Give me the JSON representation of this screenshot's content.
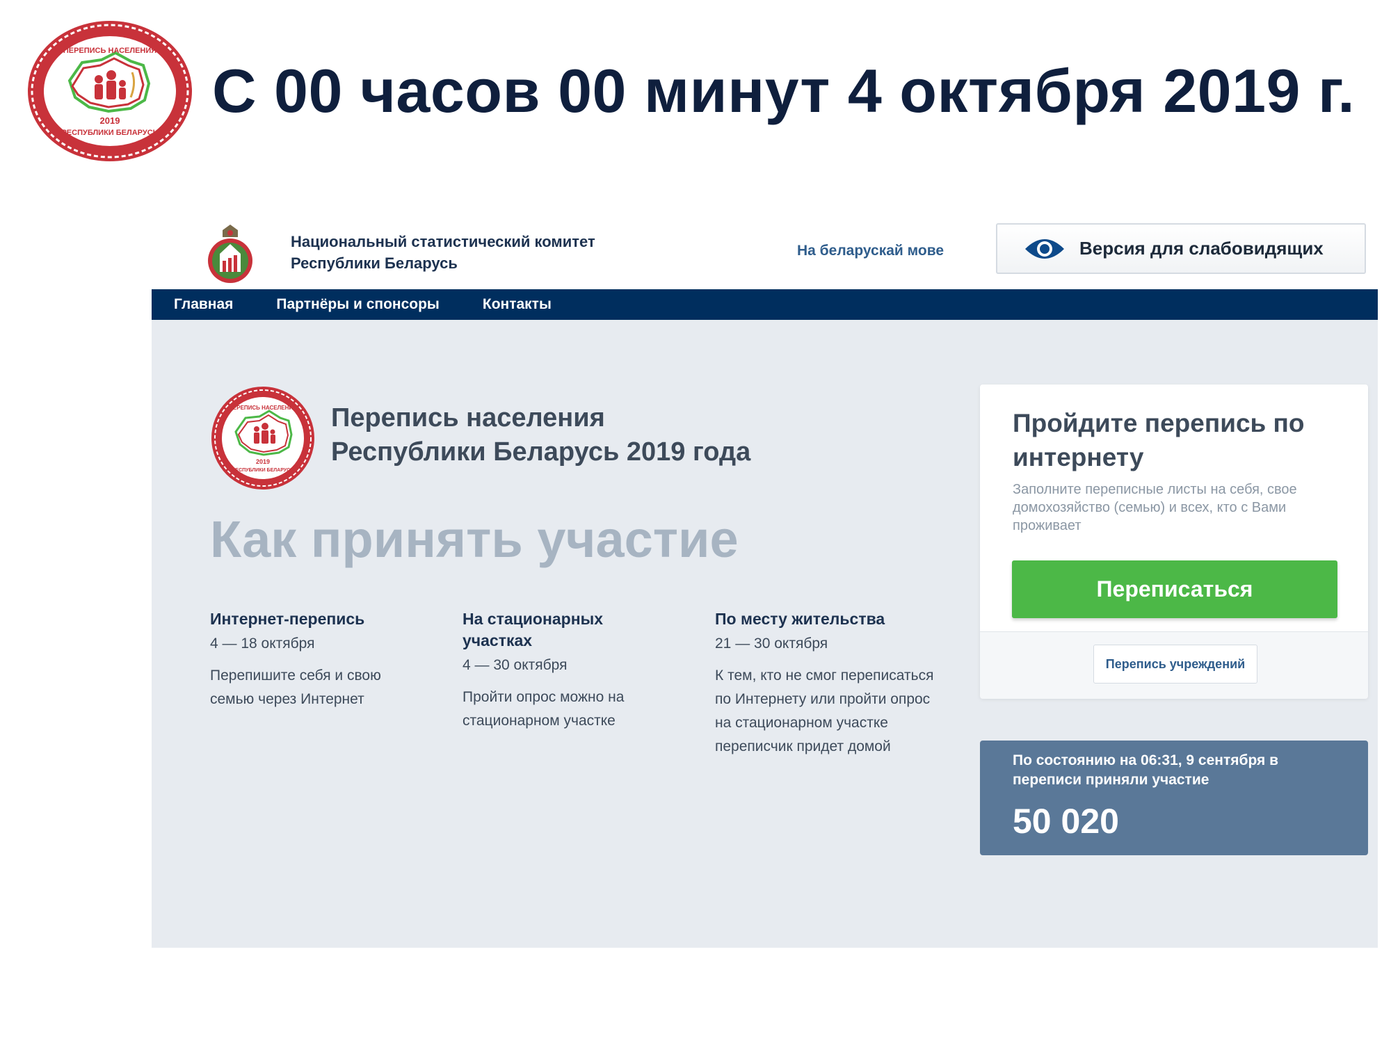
{
  "slide": {
    "title": "С 00 часов 00 минут 4 октября 2019 г.",
    "logo_text_top": "ПЕРЕПИСЬ НАСЕЛЕНИЯ",
    "logo_text_year": "2019",
    "logo_text_bottom": "РЕСПУБЛИКИ БЕЛАРУСЬ"
  },
  "header": {
    "org_name": "Национальный статистический комитет\nРеспублики Беларусь",
    "lang_link": "На беларускай мове",
    "vision_button": "Версия для слабовидящих"
  },
  "nav": {
    "items": [
      {
        "label": "Главная"
      },
      {
        "label": "Партнёры и спонсоры"
      },
      {
        "label": "Контакты"
      }
    ]
  },
  "hero": {
    "census_title": "Перепись населения\nРеспублики Беларусь 2019 года",
    "participate_heading": "Как принять участие",
    "columns": [
      {
        "title": "Интернет-перепись",
        "dates": "4 — 18 октября",
        "desc": "Перепишите себя и свою семью через Интернет"
      },
      {
        "title": "На стационарных участках",
        "dates": "4 — 30 октября",
        "desc": "Пройти опрос можно на стационарном участке"
      },
      {
        "title": "По месту жительства",
        "dates": "21 — 30 октября",
        "desc": "К тем, кто не смог переписаться по Интернету или пройти опрос на стационарном участке переписчик придет домой"
      }
    ]
  },
  "card": {
    "title": "Пройдите перепись по интернету",
    "description": "Заполните переписные листы на себя, свое домохозяйство (семью) и всех, кто с Вами проживает",
    "census_button": "Переписаться",
    "institutions_button": "Перепись учреждений"
  },
  "stats": {
    "text": "По состоянию на 06:31, 9 сентября в переписи приняли участие",
    "count": "50 020"
  },
  "colors": {
    "nav_bg": "#002e5e",
    "green_button": "#4cb847",
    "stats_bg": "#5a7898",
    "page_bg": "#e7ebf0",
    "logo_red": "#c8323a"
  }
}
